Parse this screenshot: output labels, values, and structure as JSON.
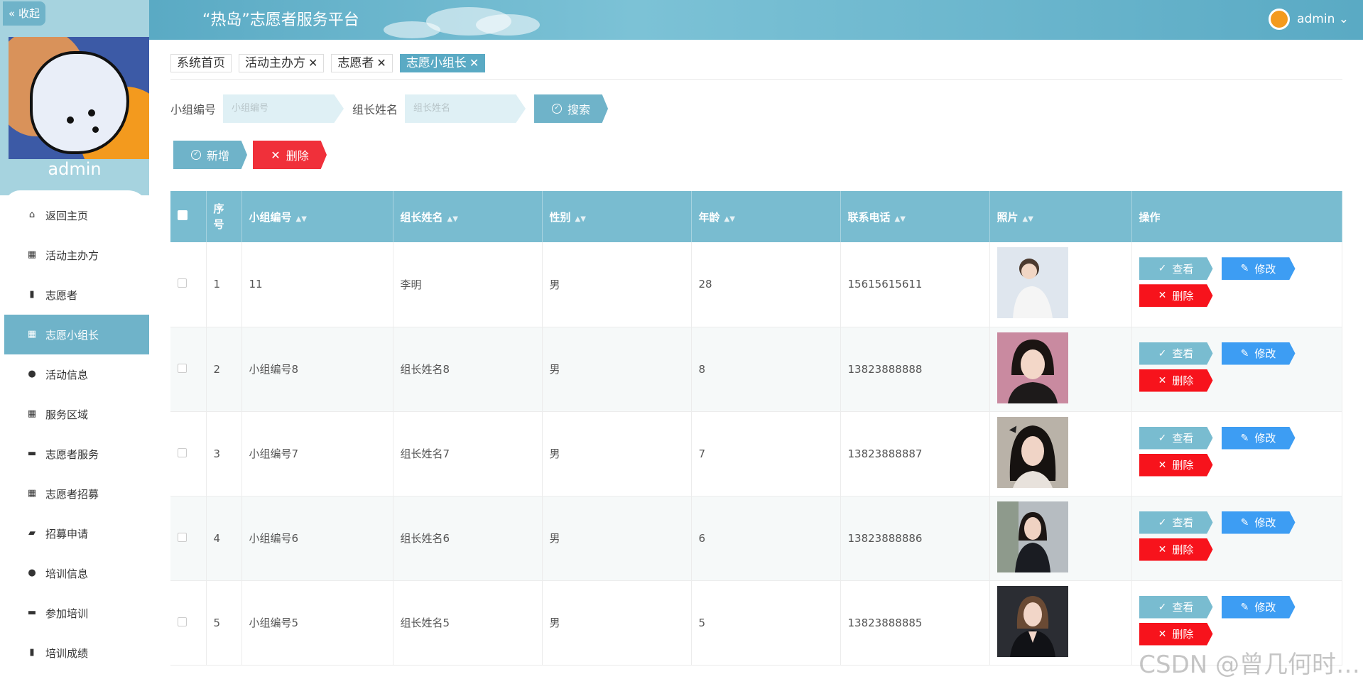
{
  "sidebar": {
    "collapse_label": "« 收起",
    "username": "admin",
    "items": [
      {
        "label": "返回主页",
        "icon": "⌂"
      },
      {
        "label": "活动主办方",
        "icon": "▦"
      },
      {
        "label": "志愿者",
        "icon": "▮"
      },
      {
        "label": "志愿小组长",
        "icon": "▦"
      },
      {
        "label": "活动信息",
        "icon": "●"
      },
      {
        "label": "服务区域",
        "icon": "▦"
      },
      {
        "label": "志愿者服务",
        "icon": "▬"
      },
      {
        "label": "志愿者招募",
        "icon": "▦"
      },
      {
        "label": "招募申请",
        "icon": "▰"
      },
      {
        "label": "培训信息",
        "icon": "●"
      },
      {
        "label": "参加培训",
        "icon": "▬"
      },
      {
        "label": "培训成绩",
        "icon": "▮"
      }
    ]
  },
  "header": {
    "title": "“热岛”志愿者服务平台",
    "user": "admin ⌄"
  },
  "tags": [
    {
      "label": "系统首页",
      "closable": false
    },
    {
      "label": "活动主办方",
      "closable": true
    },
    {
      "label": "志愿者",
      "closable": true
    },
    {
      "label": "志愿小组长",
      "closable": true
    }
  ],
  "search": {
    "group_label": "小组编号",
    "group_placeholder": "小组编号",
    "leader_label": "组长姓名",
    "leader_placeholder": "组长姓名",
    "search_btn": "搜索"
  },
  "actions": {
    "add": "新增",
    "delete": "删除"
  },
  "table": {
    "headers": {
      "seq": "序号",
      "group_no": "小组编号",
      "leader": "组长姓名",
      "gender": "性别",
      "age": "年龄",
      "phone": "联系电话",
      "photo": "照片",
      "ops": "操作"
    },
    "rows": [
      {
        "seq": "1",
        "group_no": "11",
        "leader": "李明",
        "gender": "男",
        "age": "28",
        "phone": "15615615611"
      },
      {
        "seq": "2",
        "group_no": "小组编号8",
        "leader": "组长姓名8",
        "gender": "男",
        "age": "8",
        "phone": "13823888888"
      },
      {
        "seq": "3",
        "group_no": "小组编号7",
        "leader": "组长姓名7",
        "gender": "男",
        "age": "7",
        "phone": "13823888887"
      },
      {
        "seq": "4",
        "group_no": "小组编号6",
        "leader": "组长姓名6",
        "gender": "男",
        "age": "6",
        "phone": "13823888886"
      },
      {
        "seq": "5",
        "group_no": "小组编号5",
        "leader": "组长姓名5",
        "gender": "男",
        "age": "5",
        "phone": "13823888885"
      }
    ],
    "op_labels": {
      "view": "查看",
      "edit": "修改",
      "remove": "删除"
    }
  },
  "watermark": "CSDN @曾几何时…"
}
